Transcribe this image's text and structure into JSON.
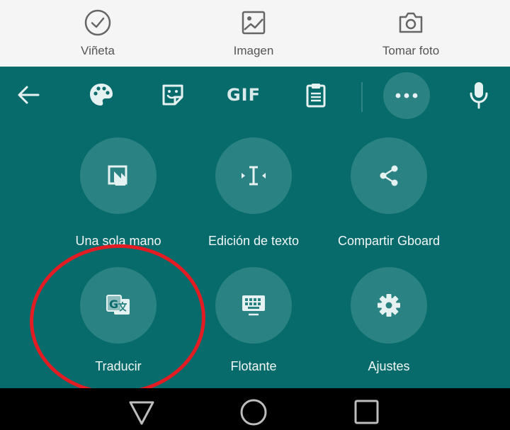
{
  "attach_bar": {
    "items": [
      {
        "label": "Viñeta",
        "icon": "check-circle-icon"
      },
      {
        "label": "Imagen",
        "icon": "image-icon"
      },
      {
        "label": "Tomar foto",
        "icon": "camera-icon"
      }
    ]
  },
  "toolbar": {
    "back_icon": "arrow-left-icon",
    "theme_icon": "palette-icon",
    "sticker_icon": "sticker-icon",
    "gif_label": "GIF",
    "clipboard_icon": "clipboard-icon",
    "more_icon": "more-horizontal-icon",
    "mic_icon": "microphone-icon"
  },
  "features": [
    {
      "label": "Una sola mano",
      "icon": "one-handed-icon"
    },
    {
      "label": "Edición de texto",
      "icon": "text-cursor-icon"
    },
    {
      "label": "Compartir Gboard",
      "icon": "share-icon"
    },
    {
      "label": "Traducir",
      "icon": "translate-icon"
    },
    {
      "label": "Flotante",
      "icon": "floating-keyboard-icon"
    },
    {
      "label": "Ajustes",
      "icon": "gear-icon"
    }
  ],
  "colors": {
    "keyboard_bg": "#076b6b",
    "circle_bg": "#2a8282",
    "annotation": "#e31b23"
  }
}
